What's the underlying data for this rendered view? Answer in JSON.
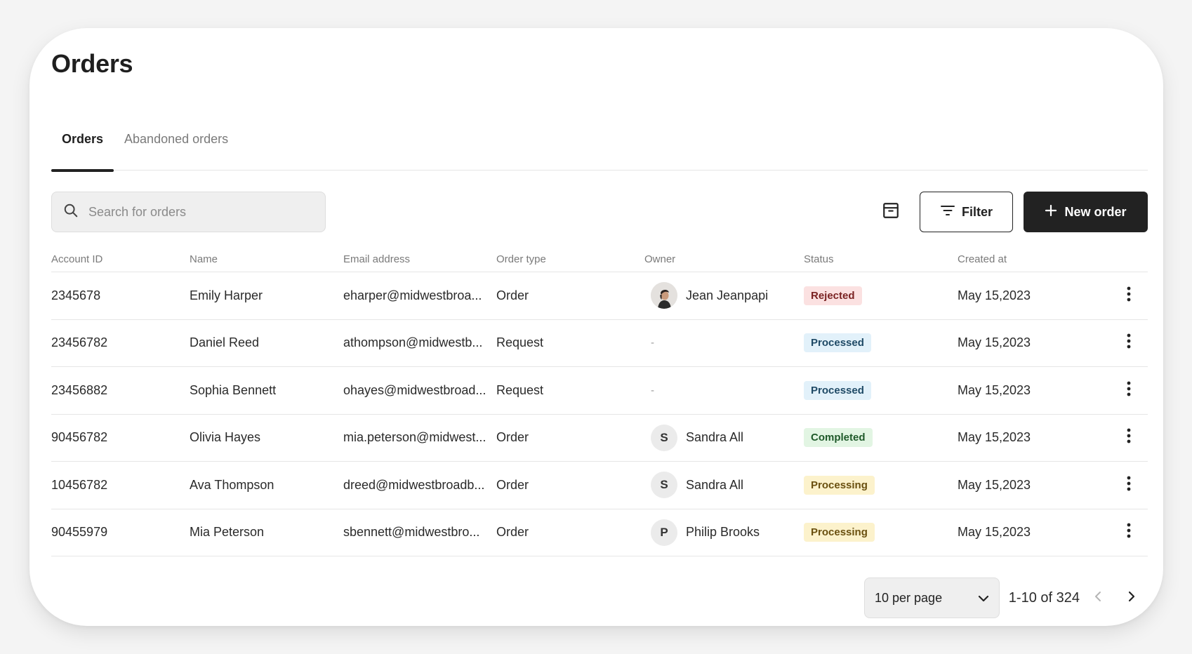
{
  "page": {
    "title": "Orders"
  },
  "tabs": [
    {
      "label": "Orders",
      "active": true
    },
    {
      "label": "Abandoned orders",
      "active": false
    }
  ],
  "search": {
    "placeholder": "Search for orders",
    "value": ""
  },
  "toolbar": {
    "filter_label": "Filter",
    "new_order_label": "New order"
  },
  "table": {
    "columns": [
      "Account ID",
      "Name",
      "Email address",
      "Order type",
      "Owner",
      "Status",
      "Created at"
    ],
    "rows": [
      {
        "account_id": "2345678",
        "name": "Emily Harper",
        "email": "eharper@midwestbroa...",
        "order_type": "Order",
        "owner": "Jean Jeanpapi",
        "owner_initial": "",
        "owner_photo": true,
        "status": "Rejected",
        "created": "May 15,2023"
      },
      {
        "account_id": "23456782",
        "name": "Daniel Reed",
        "email": "athompson@midwestb...",
        "order_type": "Request",
        "owner": "",
        "owner_initial": "",
        "owner_placeholder": "-",
        "status": "Processed",
        "created": "May 15,2023"
      },
      {
        "account_id": "23456882",
        "name": "Sophia Bennett",
        "email": "ohayes@midwestbroad...",
        "order_type": "Request",
        "owner": "",
        "owner_initial": "",
        "owner_placeholder": "-",
        "status": "Processed",
        "created": "May 15,2023"
      },
      {
        "account_id": "90456782",
        "name": "Olivia Hayes",
        "email": "mia.peterson@midwest...",
        "order_type": "Order",
        "owner": "Sandra All",
        "owner_initial": "S",
        "status": "Completed",
        "created": "May 15,2023"
      },
      {
        "account_id": "10456782",
        "name": "Ava Thompson",
        "email": "dreed@midwestbroadb...",
        "order_type": "Order",
        "owner": "Sandra All",
        "owner_initial": "S",
        "status": "Processing",
        "created": "May 15,2023"
      },
      {
        "account_id": "90455979",
        "name": "Mia Peterson",
        "email": "sbennett@midwestbro...",
        "order_type": "Order",
        "owner": "Philip Brooks",
        "owner_initial": "P",
        "status": "Processing",
        "created": "May 15,2023"
      }
    ]
  },
  "status_colors": {
    "Rejected": {
      "bg": "#fbe1e1",
      "fg": "#7a2222"
    },
    "Processed": {
      "bg": "#e2f1fa",
      "fg": "#1f4a66"
    },
    "Completed": {
      "bg": "#e2f5e3",
      "fg": "#1f5a2a"
    },
    "Processing": {
      "bg": "#fcf2cc",
      "fg": "#6a5010"
    }
  },
  "pagination": {
    "per_page_label": "10 per page",
    "range_label": "1-10 of 324"
  },
  "icons": {
    "search": "search-icon",
    "archive": "archive-icon",
    "filter": "filter-icon",
    "plus": "plus-icon",
    "more": "more-vertical-icon",
    "chevron_down": "chevron-down-icon",
    "chevron_left": "chevron-left-icon",
    "chevron_right": "chevron-right-icon"
  }
}
